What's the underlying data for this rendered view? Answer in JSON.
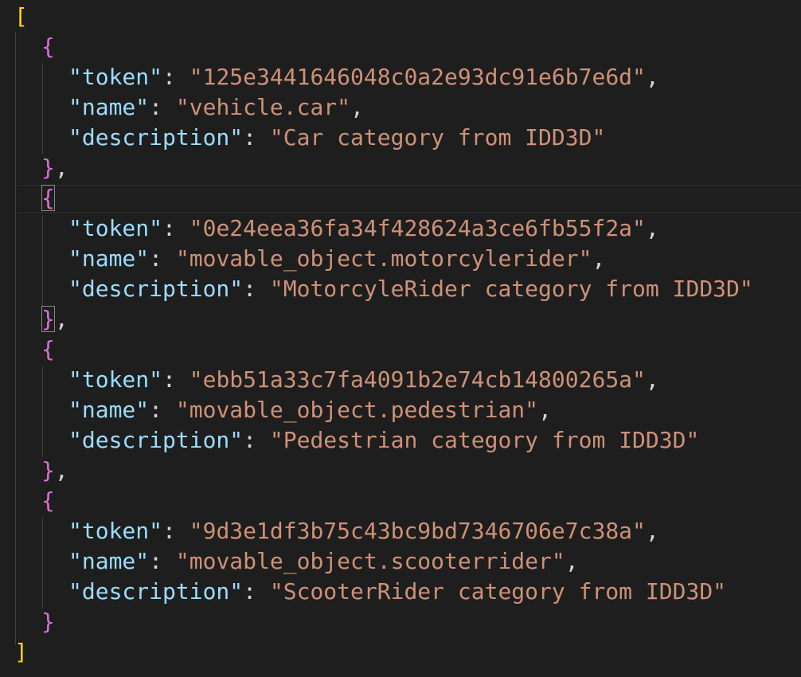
{
  "editor": {
    "open_bracket": "[",
    "close_bracket": "]",
    "open_brace": "{",
    "close_brace": "}",
    "entries": [
      {
        "token": "125e3441646048c0a2e93dc91e6b7e6d",
        "name": "vehicle.car",
        "description": "Car category from IDD3D"
      },
      {
        "token": "0e24eea36fa34f428624a3ce6fb55f2a",
        "name": "movable_object.motorcylerider",
        "description": "MotorcyleRider category from IDD3D"
      },
      {
        "token": "ebb51a33c7fa4091b2e74cb14800265a",
        "name": "movable_object.pedestrian",
        "description": "Pedestrian category from IDD3D"
      },
      {
        "token": "9d3e1df3b75c43bc9bd7346706e7c38a",
        "name": "movable_object.scooterrider",
        "description": "ScooterRider category from IDD3D"
      }
    ],
    "keys": {
      "token": "\"token\"",
      "name": "\"name\"",
      "description": "\"description\""
    }
  },
  "colors": {
    "background": "#1e1e1e",
    "outer_bracket": "#ffd700",
    "brace": "#da70d6",
    "key": "#9cdcfe",
    "string": "#ce9178",
    "punctuation": "#d4d4d4"
  }
}
